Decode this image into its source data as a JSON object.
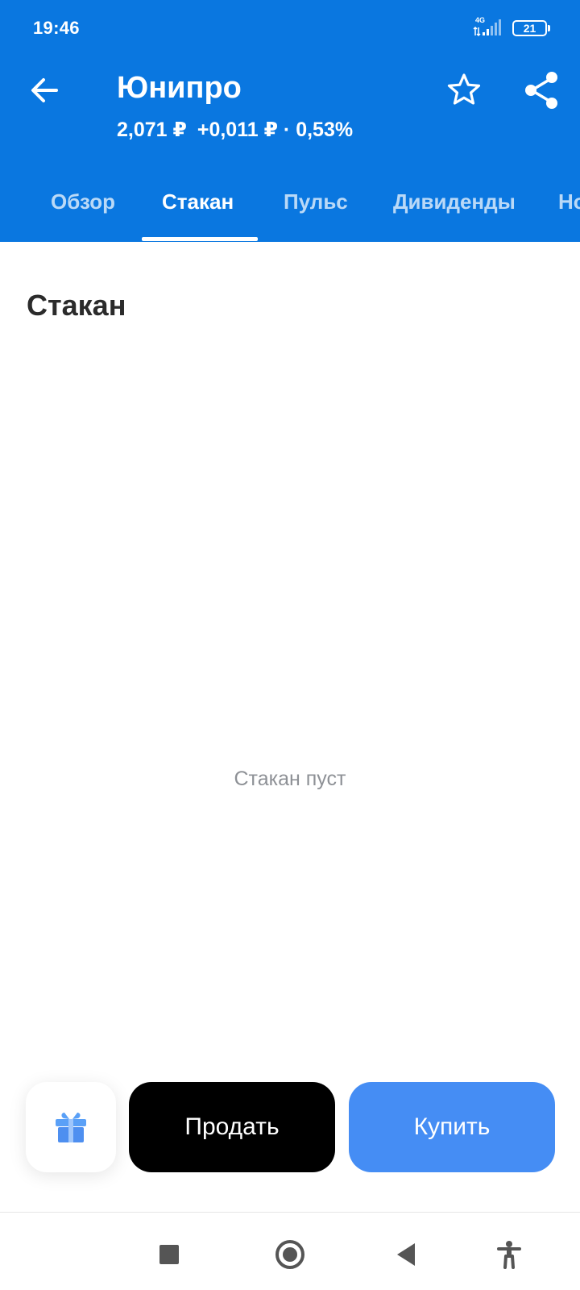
{
  "status_bar": {
    "time": "19:46",
    "network": "4G",
    "battery": "21"
  },
  "header": {
    "title": "Юнипро",
    "price": "2,071 ₽",
    "change": "+0,011 ₽ · 0,53%",
    "background_color": "#0a77e0"
  },
  "tabs": [
    {
      "label": "Обзор",
      "active": false
    },
    {
      "label": "Стакан",
      "active": true
    },
    {
      "label": "Пульс",
      "active": false
    },
    {
      "label": "Дивиденды",
      "active": false
    },
    {
      "label": "Но",
      "active": false
    }
  ],
  "main": {
    "section_title": "Стакан",
    "empty_message": "Стакан пуст"
  },
  "actions": {
    "gift_icon": "gift-icon",
    "sell_label": "Продать",
    "buy_label": "Купить",
    "sell_color": "#000000",
    "buy_color": "#458df4"
  },
  "system_nav": {
    "icons": [
      "recents-icon",
      "home-icon",
      "back-icon",
      "accessibility-icon"
    ]
  }
}
